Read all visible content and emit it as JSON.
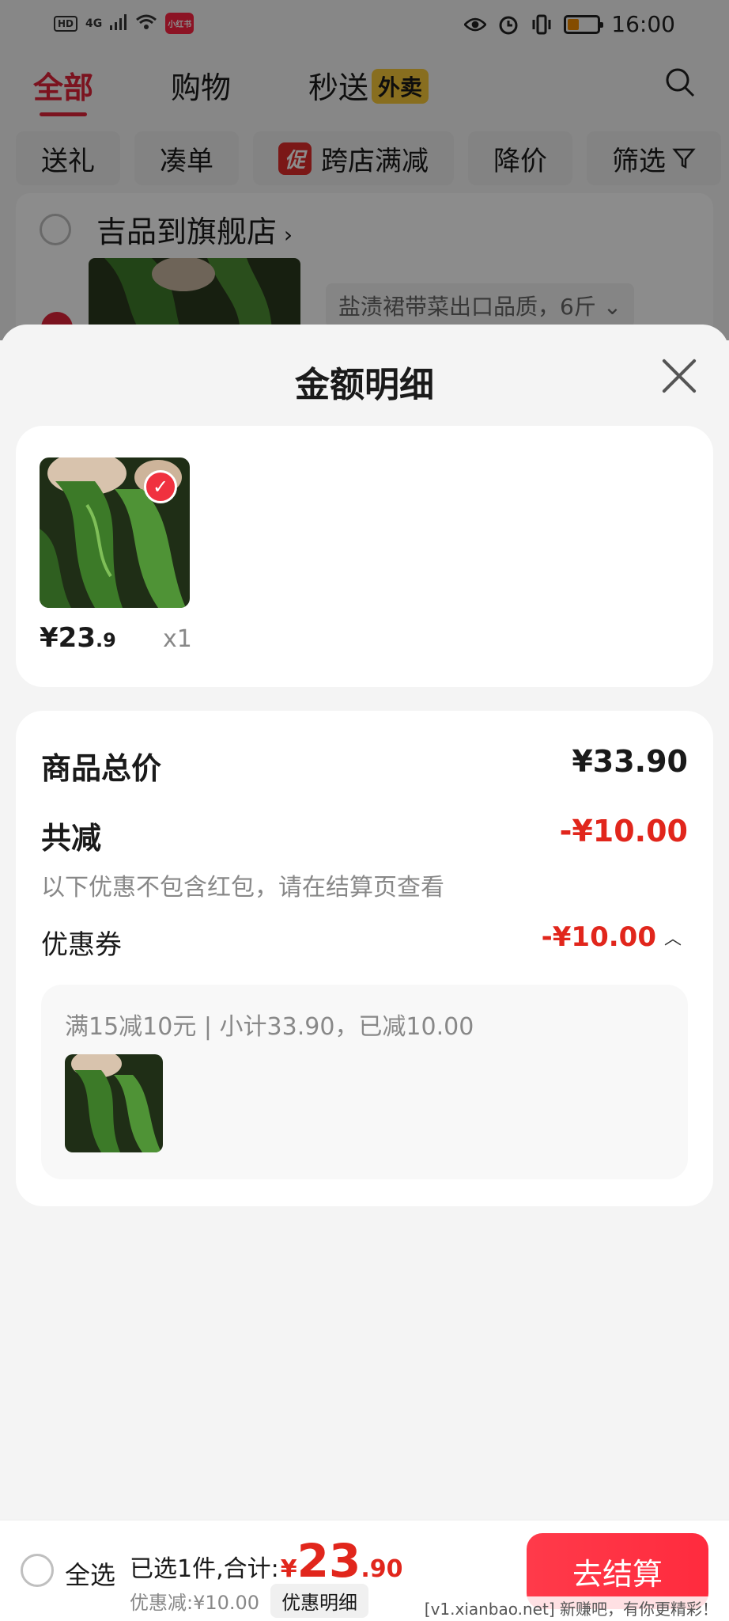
{
  "status_bar": {
    "hd": "HD",
    "signal": "4G",
    "app_badge": "小红书",
    "time": "16:00"
  },
  "top_nav": {
    "tabs": [
      {
        "label": "全部",
        "active": true
      },
      {
        "label": "购物",
        "active": false
      },
      {
        "label": "秒送",
        "active": false
      }
    ],
    "takeout_badge": "外卖"
  },
  "filters": {
    "chips": [
      "送礼",
      "凑单",
      "跨店满减",
      "降价",
      "筛选"
    ],
    "promo_tag": "促"
  },
  "store": {
    "name": "吉品到旗舰店",
    "variant": "盐渍裙带菜出口品质，6斤"
  },
  "sheet": {
    "title": "金额明细",
    "item": {
      "price_int": "¥23",
      "price_dec": ".9",
      "qty": "x1"
    },
    "summary": {
      "total_label": "商品总价",
      "total_value": "¥33.90",
      "discount_label": "共减",
      "discount_value": "-¥10.00",
      "hint": "以下优惠不包含红包，请在结算页查看",
      "coupon_label": "优惠券",
      "coupon_value": "-¥10.00",
      "coupon_rule": "满15减10元 | 小计33.90，已减10.00"
    }
  },
  "bottom_bar": {
    "select_all": "全选",
    "selected_text": "已选1件,合计:",
    "currency": "¥",
    "total_int": "23",
    "total_dec": ".90",
    "discount_text": "优惠减:¥10.00",
    "detail_button": "优惠明细",
    "checkout": "去结算",
    "watermark": "[v1.xianbao.net] 新赚吧，有你更精彩！"
  },
  "colors": {
    "accent_red": "#e1261c",
    "brand_red": "#ff2442",
    "badge_yellow": "#f7c93a"
  }
}
